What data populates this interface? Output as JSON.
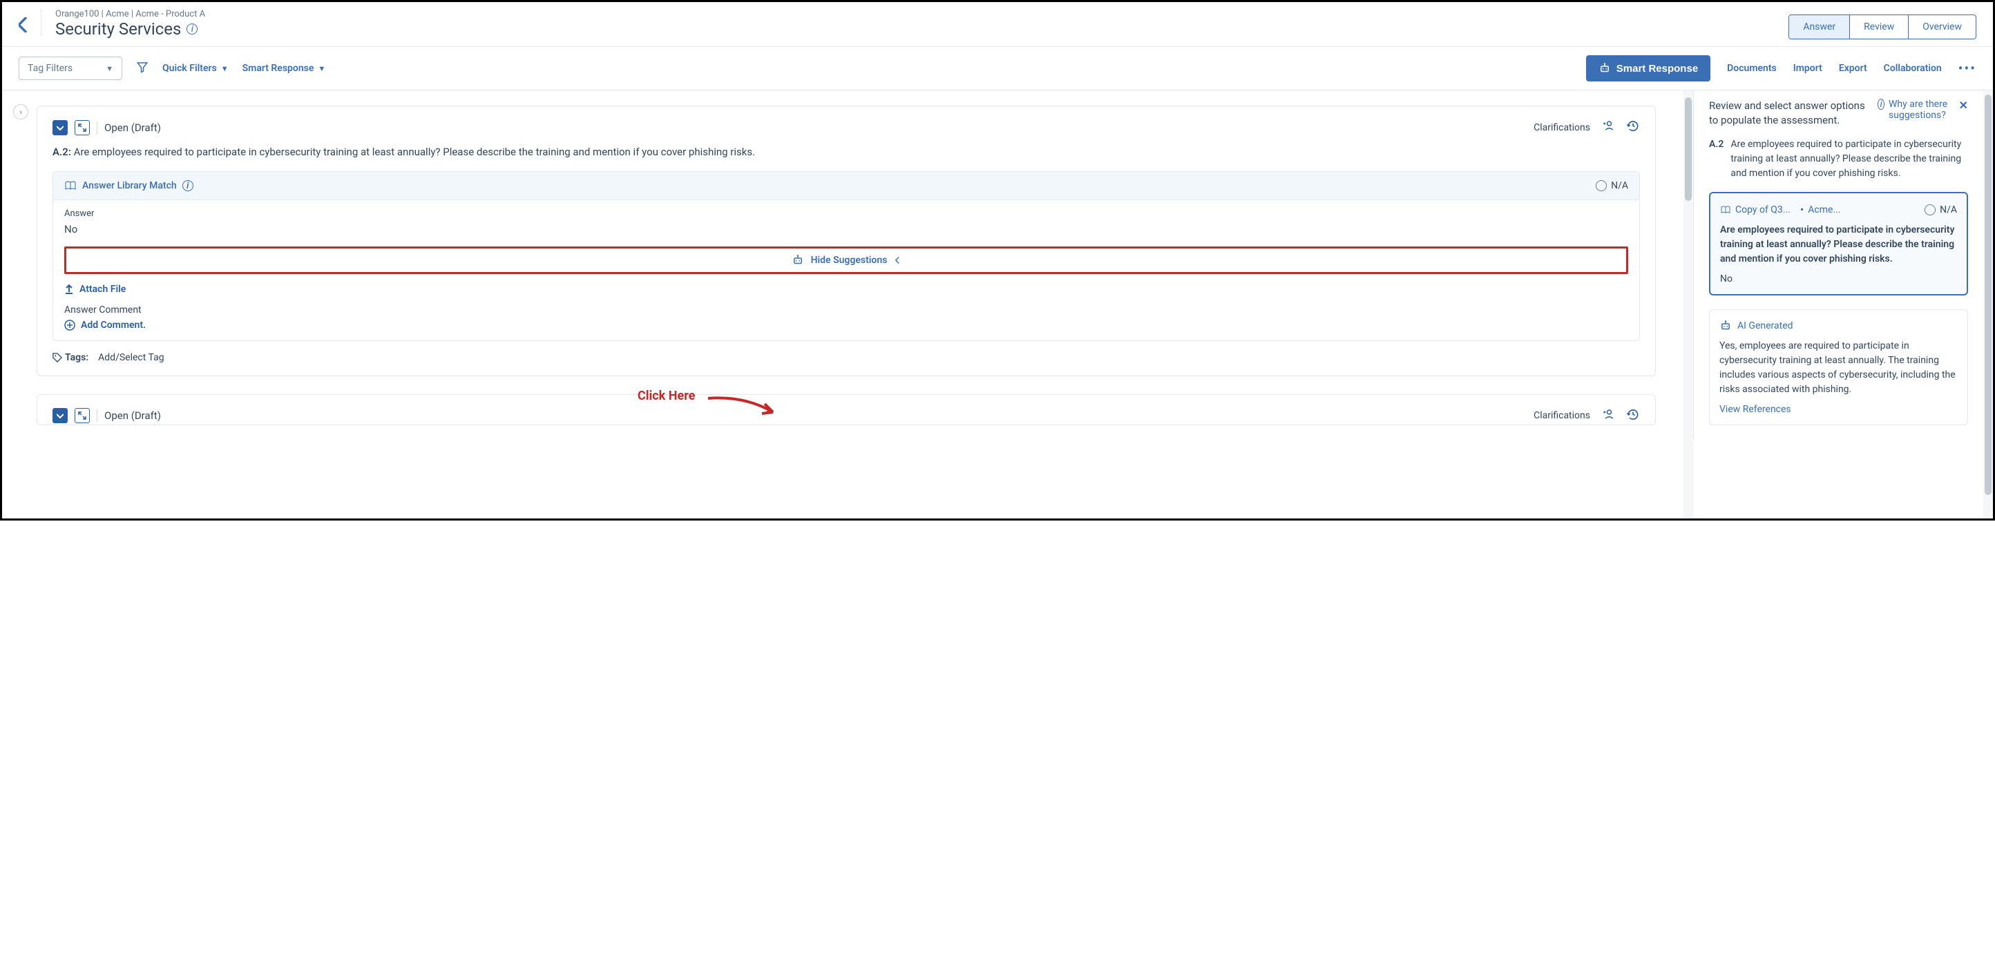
{
  "header": {
    "breadcrumb": "Orange100 | Acme | Acme - Product A",
    "title": "Security Services",
    "tabs": {
      "answer": "Answer",
      "review": "Review",
      "overview": "Overview"
    }
  },
  "toolbar": {
    "tag_filters": "Tag Filters",
    "quick_filters": "Quick Filters",
    "smart_response_link": "Smart Response",
    "smart_response_btn": "Smart Response",
    "documents": "Documents",
    "import": "Import",
    "export": "Export",
    "collaboration": "Collaboration"
  },
  "main": {
    "cards": [
      {
        "status": "Open (Draft)",
        "clarifications": "Clarifications",
        "q_num": "A.2:",
        "q_text": "Are employees required to participate in cybersecurity training at least annually? Please describe the training and mention if you cover phishing risks.",
        "answer_lib_match": "Answer Library Match",
        "na": "N/A",
        "answer_label": "Answer",
        "answer_value": "No",
        "hide_suggestions": "Hide Suggestions",
        "attach_file": "Attach File",
        "answer_comment": "Answer Comment",
        "add_comment": "Add Comment.",
        "tags_label": "Tags:",
        "tags_value": "Add/Select Tag"
      },
      {
        "status": "Open (Draft)",
        "clarifications": "Clarifications"
      }
    ]
  },
  "side": {
    "instruction": "Review and select answer options to populate the assessment.",
    "why_link": "Why are there suggestions?",
    "q_num": "A.2",
    "q_text": "Are employees required to participate in cybersecurity training at least annually? Please describe the training and mention if you cover phishing risks.",
    "match_card": {
      "copy_link": "Copy of Q3...",
      "acme_link": "Acme...",
      "na": "N/A",
      "body": "Are employees required to participate in cybersecurity training at least annually? Please describe the training and mention if you cover phishing risks.",
      "answer": "No"
    },
    "ai_card": {
      "title": "AI Generated",
      "body": "Yes, employees are required to participate in cybersecurity training at least annually. The training includes various aspects of cybersecurity, including the risks associated with phishing.",
      "view_refs": "View References"
    }
  },
  "annotation": {
    "click_here": "Click Here"
  }
}
